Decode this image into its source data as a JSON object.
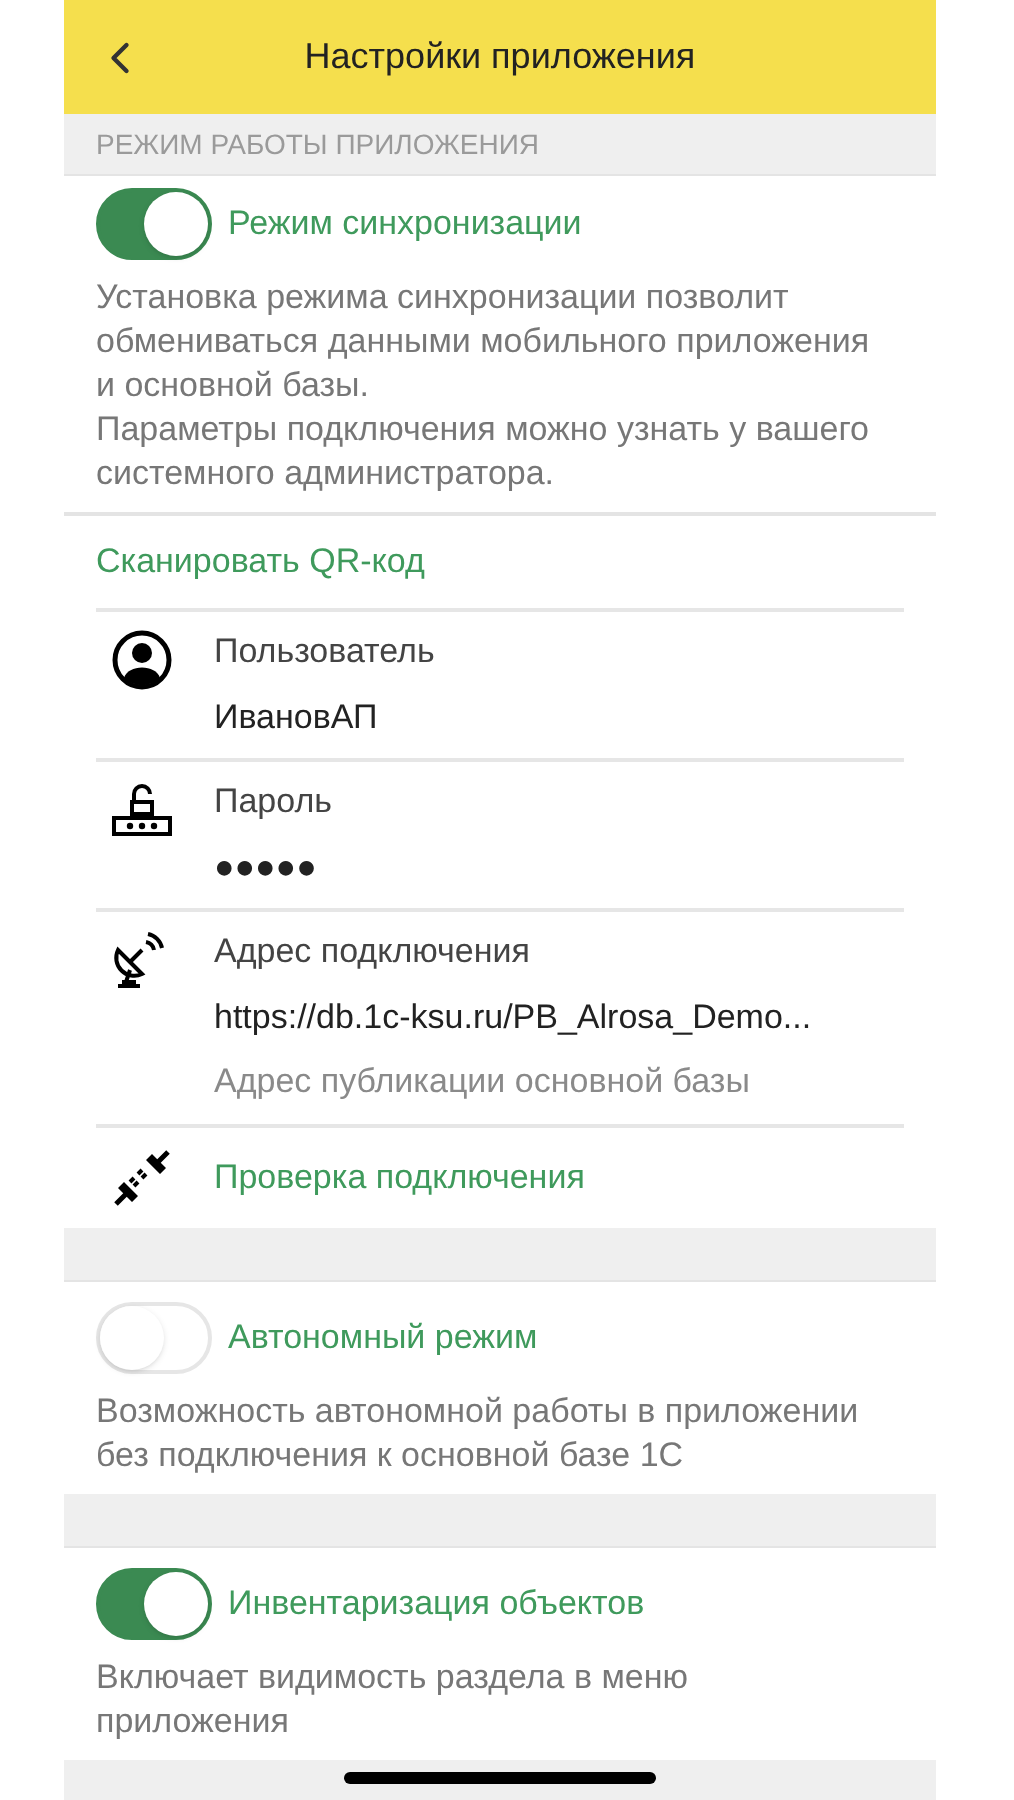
{
  "header": {
    "title": "Настройки приложения"
  },
  "section_title": "РЕЖИМ РАБОТЫ ПРИЛОЖЕНИЯ",
  "sync": {
    "label": "Режим синхронизации",
    "on": true,
    "description": [
      "Установка режима синхронизации позволит обмениваться данными мобильного приложения и основной базы.",
      "Параметры подключения можно узнать у вашего системного администратора."
    ]
  },
  "scan_link": "Сканировать QR-код",
  "fields": [
    {
      "kind": "user",
      "label": "Пользователь",
      "value": "ИвановАП"
    },
    {
      "kind": "password",
      "label": "Пароль",
      "value": "●●●●●"
    },
    {
      "kind": "address",
      "label": "Адрес подключения",
      "value": "https://db.1c-ksu.ru/PB_Alrosa_Demo...",
      "hint": "Адрес публикации основной базы"
    }
  ],
  "check_link": "Проверка подключения",
  "offline": {
    "label": "Автономный режим",
    "on": false,
    "description": [
      "Возможность автономной работы в приложении без подключения к основной базе 1С"
    ]
  },
  "inventory": {
    "label": "Инвентаризация объектов",
    "on": true,
    "description": [
      "Включает видимость раздела в меню приложения"
    ]
  }
}
